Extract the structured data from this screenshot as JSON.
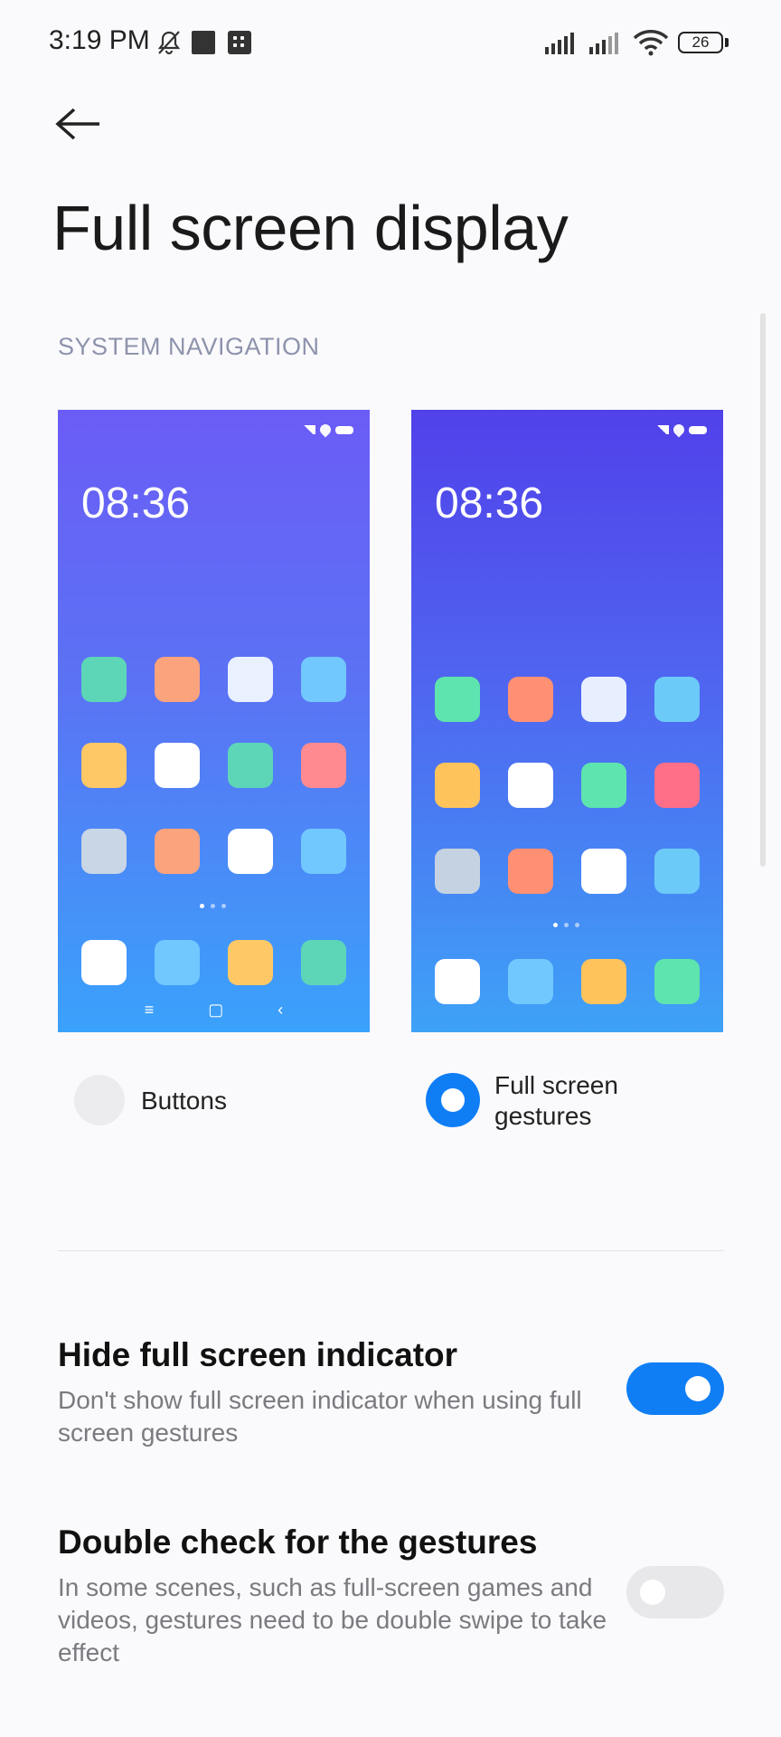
{
  "status_bar": {
    "time": "3:19 PM",
    "battery": "26"
  },
  "page": {
    "title": "Full screen display",
    "section": "SYSTEM NAVIGATION"
  },
  "previews": [
    {
      "time": "08:36",
      "tiles": [
        "#5dd6b8",
        "#fba37d",
        "#e9f0ff",
        "#71c8ff",
        "#ffc866",
        "#ffffff",
        "#5dd6b8",
        "#ff8a8f",
        "#c8d6e6",
        "#fba37d",
        "#ffffff",
        "#71c8ff"
      ],
      "dock": [
        "#ffffff",
        "#71c8ff",
        "#ffc866",
        "#5dd6b8"
      ],
      "nav": {
        "menu": "≡",
        "home": "▢",
        "back": "‹"
      }
    },
    {
      "time": "08:36",
      "tiles": [
        "#5ee4ae",
        "#ff9073",
        "#e7efff",
        "#6ccaf8",
        "#ffc35c",
        "#ffffff",
        "#5ee4ae",
        "#ff6f88",
        "#c5d2e2",
        "#ff9073",
        "#ffffff",
        "#6ccaf8"
      ],
      "dock": [
        "#ffffff",
        "#71c8ff",
        "#ffc35c",
        "#5ee4ae"
      ]
    }
  ],
  "options": {
    "buttons": "Buttons",
    "gestures": "Full screen gestures"
  },
  "settings": {
    "hide_indicator": {
      "title": "Hide full screen indicator",
      "desc": "Don't show full screen indicator when using full screen gestures",
      "enabled": true
    },
    "double_check": {
      "title": "Double check for the gestures",
      "desc": "In some scenes, such as full-screen games and videos, gestures need to be double swipe to take effect",
      "enabled": false
    }
  },
  "colors": {
    "accent": "#0f7ef5",
    "section": "#8e93ac"
  }
}
